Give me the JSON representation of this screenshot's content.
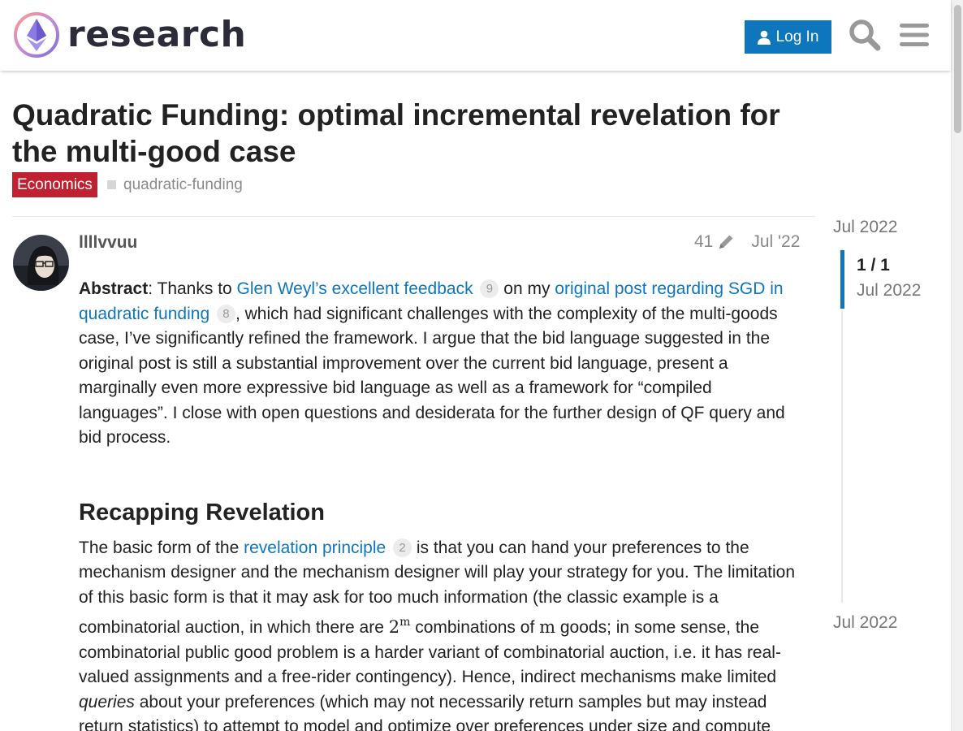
{
  "header": {
    "logo_text": "research",
    "login_label": "Log In",
    "icons": [
      "search-icon",
      "hamburger-menu-icon"
    ],
    "accent_color": "#0e76bd"
  },
  "topic": {
    "title": "Quadratic Funding: optimal incremental revelation for the multi-good case",
    "category": "Economics",
    "category_color": "#c0202f",
    "tag": "quadratic-funding"
  },
  "post": {
    "username": "llllvvuu",
    "edit_count": "41",
    "date": "Jul '22",
    "abstract": {
      "label": "Abstract",
      "t1": ": Thanks to ",
      "link1": "Glen Weyl’s excellent feedback",
      "link1_clicks": "9",
      "t2": " on my ",
      "link2": "original post regarding SGD in quadratic funding",
      "link2_clicks": "8",
      "t3": ", which had significant challenges with the complexity of the multi-goods case, I’ve significantly refined the framework. I argue that the bid language suggested in the original post is still a substantial improvement over the current bid language, present a marginally even more expressive bid language as well as a framework for “compiled languages”. I close with open questions and desiderata for the further design of QF query and bid process."
    },
    "heading": "Recapping Revelation",
    "para2": {
      "t1": "The basic form of the ",
      "link": "revelation principle",
      "link_clicks": "2",
      "t2": " is that you can hand your preferences to the mechanism designer and the mechanism designer will play your strategy for you. The limitation of this basic form is that it may ask for too much information (the classic example is a combinatorial auction, in which there are ",
      "math_base": "2",
      "math_exp": "m",
      "t3": " combinations of ",
      "math_m": "m",
      "t4": " goods; in some sense, the combinatorial public good problem is a harder variant of combinatorial auction, i.e. it has real-valued assignments and a free-rider contingency). Hence, indirect mechanisms make limited ",
      "em": "queries",
      "t5": " about your preferences (which may not necessarily return samples but may instead return statistics) to attempt to model and optimize over preferences under size and compute constraints. The advantage of the indirect approach is that it is less than"
    }
  },
  "timeline": {
    "top_date": "Jul 2022",
    "position": "1 / 1",
    "position_date": "Jul 2022",
    "bottom_date": "Jul 2022"
  }
}
